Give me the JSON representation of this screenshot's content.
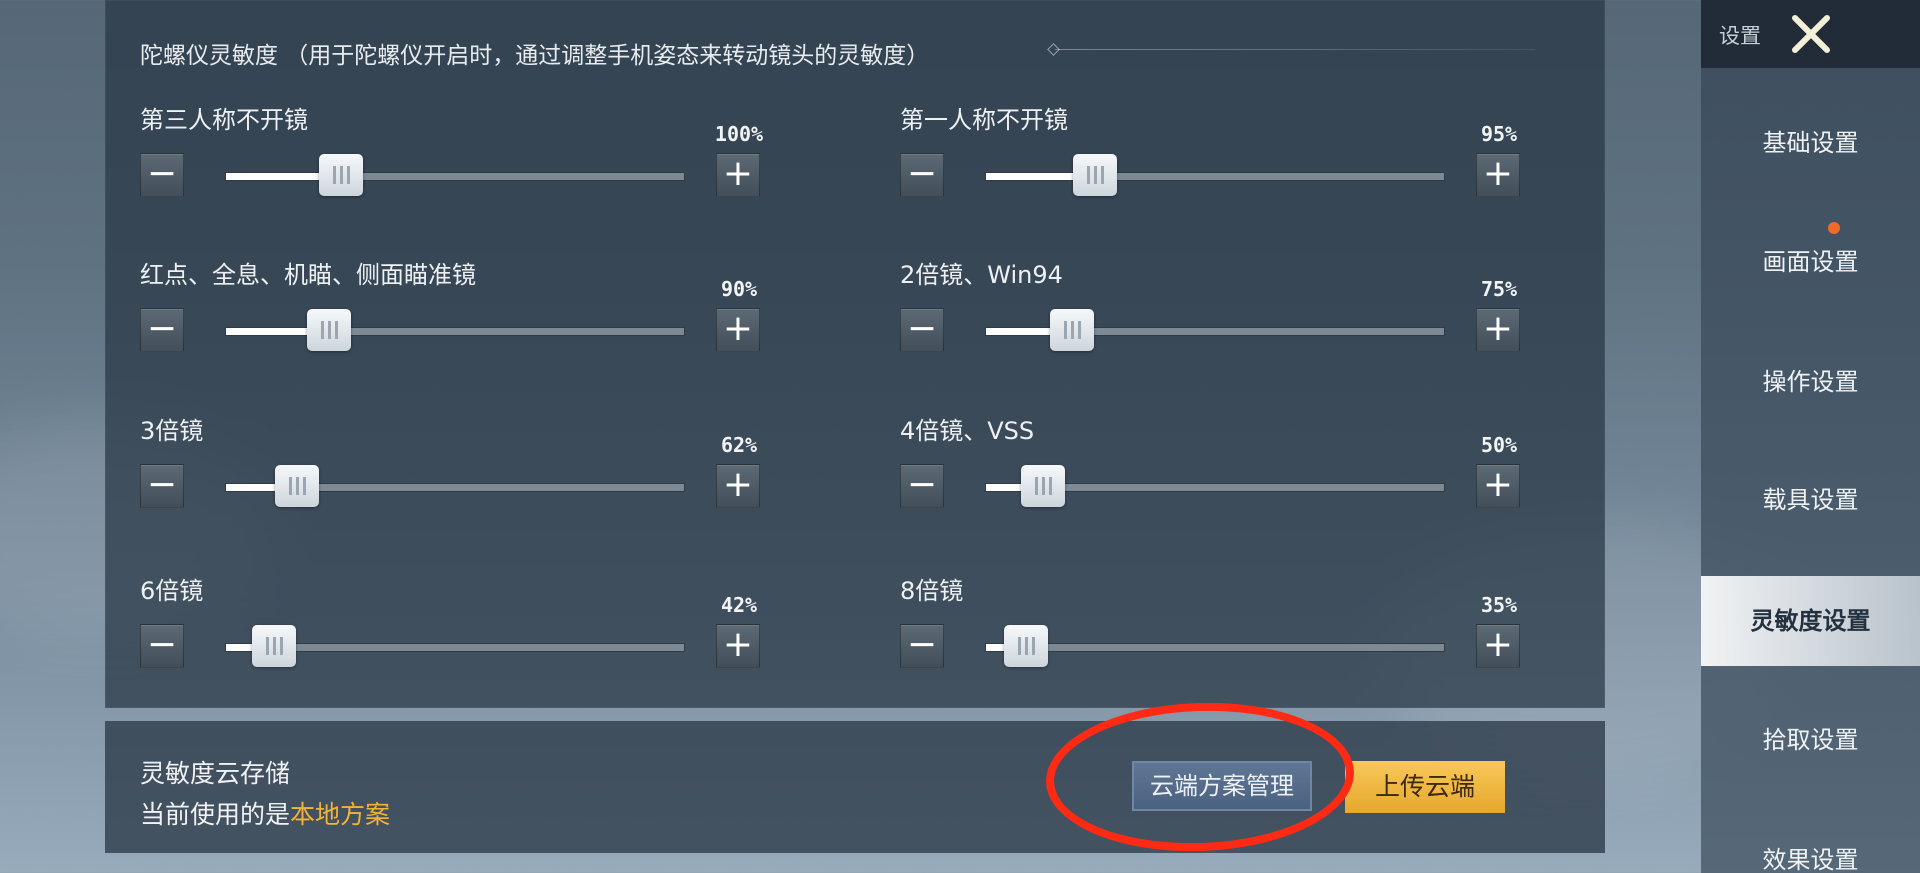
{
  "section_header": "陀螺仪灵敏度 （用于陀螺仪开启时，通过调整手机姿态来转动镜头的灵敏度）",
  "controls": {
    "minus_symbol": "−",
    "plus_symbol": "+"
  },
  "sliders": [
    {
      "label": "第三人称不开镜",
      "value_text": "100%",
      "value": 100
    },
    {
      "label": "第一人称不开镜",
      "value_text": "95%",
      "value": 95
    },
    {
      "label": "红点、全息、机瞄、侧面瞄准镜",
      "value_text": "90%",
      "value": 90
    },
    {
      "label": "2倍镜、Win94",
      "value_text": "75%",
      "value": 75
    },
    {
      "label": "3倍镜",
      "value_text": "62%",
      "value": 62
    },
    {
      "label": "4倍镜、VSS",
      "value_text": "50%",
      "value": 50
    },
    {
      "label": "6倍镜",
      "value_text": "42%",
      "value": 42
    },
    {
      "label": "8倍镜",
      "value_text": "35%",
      "value": 35
    }
  ],
  "slider_scale_max": 400,
  "cloud": {
    "title": "灵敏度云存储",
    "current_prefix": "当前使用的是",
    "current_plan": "本地方案",
    "manage_button": "云端方案管理",
    "upload_button": "上传云端"
  },
  "sidebar": {
    "title": "设置",
    "items": [
      {
        "label": "基础设置",
        "active": false
      },
      {
        "label": "画面设置",
        "active": false,
        "badge": true
      },
      {
        "label": "操作设置",
        "active": false
      },
      {
        "label": "载具设置",
        "active": false
      },
      {
        "label": "灵敏度设置",
        "active": true
      },
      {
        "label": "拾取设置",
        "active": false
      },
      {
        "label": "效果设置",
        "active": false
      }
    ]
  },
  "colors": {
    "accent_gold": "#f2b33a",
    "highlight_red": "#ff2a14",
    "notify_orange": "#f06a2a"
  }
}
